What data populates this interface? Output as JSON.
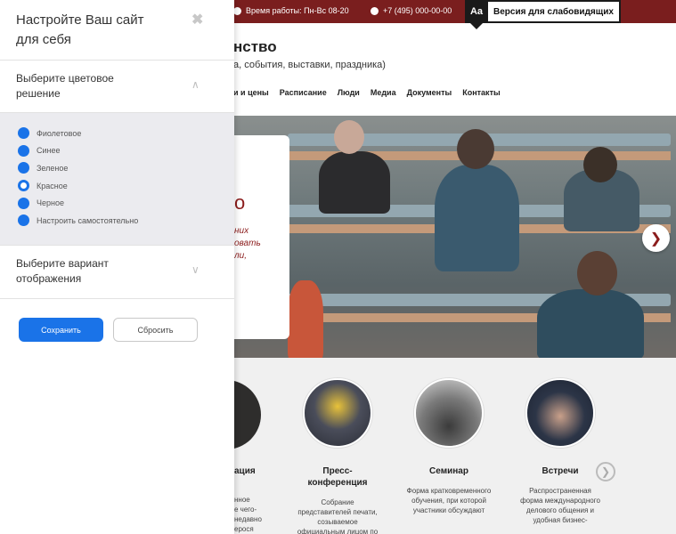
{
  "topbar": {
    "hours": "Время работы: Пн-Вс 08-20",
    "phone": "+7 (495) 000-00-00",
    "a11y_icon": "Aa",
    "a11y_label": "Версия для слабовидящих"
  },
  "site": {
    "title": "нство",
    "subtitle": "а, события, выставки, праздника)",
    "nav": [
      "и и цены",
      "Расписание",
      "Люди",
      "Медиа",
      "Документы",
      "Контакты"
    ]
  },
  "hero": {
    "big": "о",
    "text_lines": [
      "них",
      "овать",
      "ли,"
    ]
  },
  "cards": {
    "partial_title": "ация",
    "partial_desc": [
      "нное",
      "е чего-",
      "недавно",
      "ерося"
    ],
    "items": [
      {
        "title": "Пресс-конференция",
        "desc": "Собрание представителей печати, созываемое официальным лицом по"
      },
      {
        "title": "Семинар",
        "desc": "Форма кратковременного обучения, при которой участники обсуждают"
      },
      {
        "title": "Встречи",
        "desc": "Распространенная форма международного делового общения и удобная бизнес-"
      }
    ]
  },
  "panel": {
    "title": "Настройте Ваш сайт для себя",
    "close_icon": "close-icon",
    "color_section_label": "Выберите цветовое решение",
    "color_options": [
      {
        "label": "Фиолетовое",
        "selected": false
      },
      {
        "label": "Синее",
        "selected": false
      },
      {
        "label": "Зеленое",
        "selected": false
      },
      {
        "label": "Красное",
        "selected": true
      },
      {
        "label": "Черное",
        "selected": false
      },
      {
        "label": "Настроить самостоятельно",
        "selected": false
      }
    ],
    "view_section_label": "Выберите вариант отображения",
    "save_label": "Сохранить",
    "reset_label": "Сбросить"
  },
  "colors": {
    "accent": "#1a73e8",
    "topbar": "#7a1e1e",
    "brand": "#8b1c1c"
  }
}
